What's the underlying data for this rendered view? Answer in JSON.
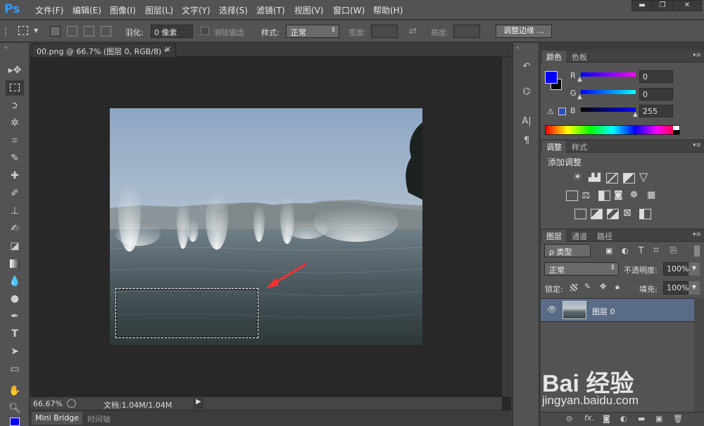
{
  "app": {
    "logo": "Ps"
  },
  "menu": [
    "文件(F)",
    "编辑(E)",
    "图像(I)",
    "图层(L)",
    "文字(Y)",
    "选择(S)",
    "滤镜(T)",
    "视图(V)",
    "窗口(W)",
    "帮助(H)"
  ],
  "window_controls": {
    "minimize": "▬",
    "maximize": "❐",
    "close": "✕"
  },
  "options": {
    "feather_label": "羽化:",
    "feather_value": "0 像素",
    "antialias_label": "消除锯齿",
    "style_label": "样式:",
    "style_value": "正常",
    "width_label": "宽度:",
    "height_label": "高度:",
    "refine_edge": "调整边缘 ..."
  },
  "document": {
    "tab_title": "00.png @ 66.7% (图层 0, RGB/8) *",
    "zoom": "66.67%",
    "doc_info": "文档:1.04M/1.04M"
  },
  "bottom_tabs": [
    "Mini Bridge",
    "时间轴"
  ],
  "color_panel": {
    "tabs": [
      "颜色",
      "色板"
    ],
    "r_label": "R",
    "r_value": "0",
    "g_label": "G",
    "g_value": "0",
    "b_label": "B",
    "b_value": "255",
    "foreground": "#0000ff",
    "background": "#000000"
  },
  "adjust_panel": {
    "tabs": [
      "调整",
      "样式"
    ],
    "title": "添加调整"
  },
  "layers_panel": {
    "tabs": [
      "图层",
      "通道",
      "路径"
    ],
    "filter_label": "ρ 类型",
    "blend_mode": "正常",
    "opacity_label": "不透明度:",
    "opacity_value": "100%",
    "lock_label": "锁定:",
    "fill_label": "填充:",
    "fill_value": "100%",
    "layers": [
      {
        "name": "图层 0",
        "visible": true
      }
    ]
  },
  "watermark": {
    "line1": "Bai 经验",
    "line2": "jingyan.baidu.com"
  }
}
